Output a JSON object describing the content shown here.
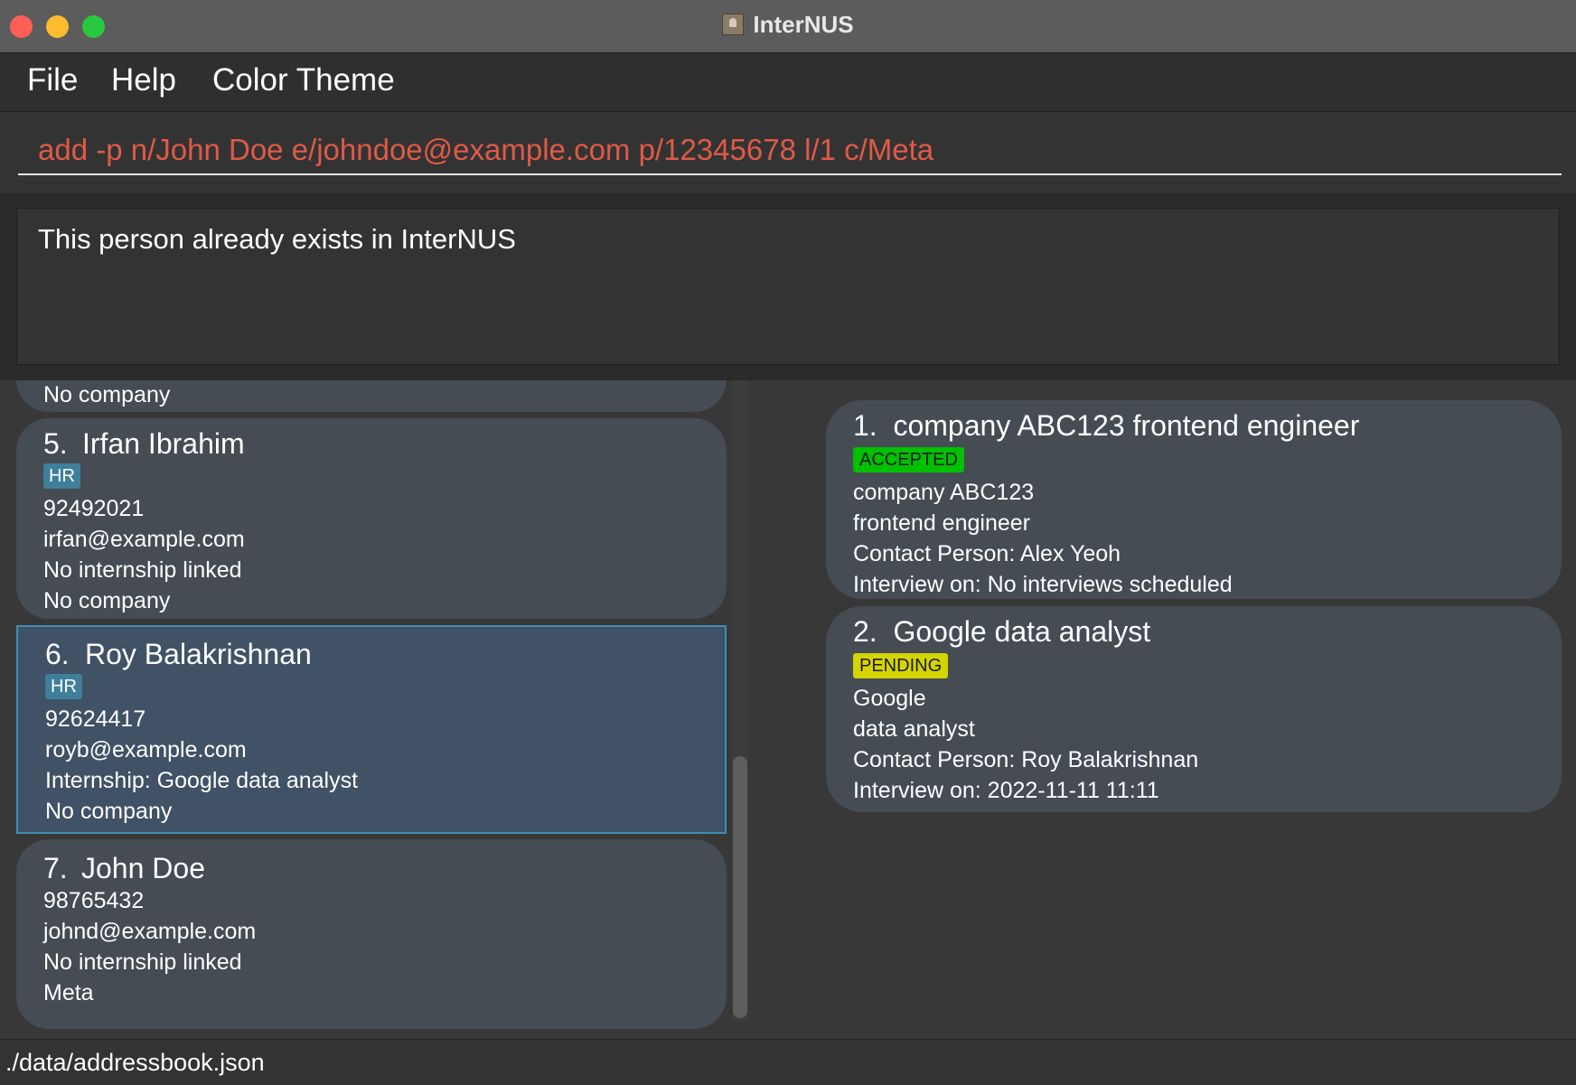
{
  "window": {
    "title": "InterNUS"
  },
  "menu": [
    "File",
    "Help",
    "Color Theme"
  ],
  "command": {
    "value": "add -p n/John Doe e/johndoe@example.com p/12345678 l/1 c/Meta"
  },
  "result": {
    "text": "This person already exists in InterNUS"
  },
  "persons": [
    {
      "partial_text": "No company"
    },
    {
      "index": "5.",
      "name": "Irfan Ibrahim",
      "tag": "HR",
      "phone": "92492021",
      "email": "irfan@example.com",
      "internship": "No internship linked",
      "company": "No company"
    },
    {
      "index": "6.",
      "name": "Roy Balakrishnan",
      "tag": "HR",
      "phone": "92624417",
      "email": "royb@example.com",
      "internship": "Internship: Google data analyst",
      "company": "No company",
      "selected": true
    },
    {
      "index": "7.",
      "name": "John Doe",
      "phone": "98765432",
      "email": "johnd@example.com",
      "internship": "No internship linked",
      "company": "Meta"
    }
  ],
  "internships": [
    {
      "index": "1.",
      "title": "company ABC123 frontend engineer",
      "status": "ACCEPTED",
      "status_color": "#00c000",
      "company": "company ABC123",
      "role": "frontend engineer",
      "contact": "Contact Person: Alex Yeoh",
      "interview": "Interview on: No interviews scheduled"
    },
    {
      "index": "2.",
      "title": "Google data analyst",
      "status": "PENDING",
      "status_color": "#d4d400",
      "company": "Google",
      "role": "data analyst",
      "contact": "Contact Person: Roy Balakrishnan",
      "interview": "Interview on: 2022-11-11 11:11"
    }
  ],
  "status_bar": {
    "path": "./data/addressbook.json"
  },
  "colors": {
    "accent_command": "#e05a47",
    "selected_border": "#3d8fb4",
    "tag": "#3f7f9a"
  }
}
